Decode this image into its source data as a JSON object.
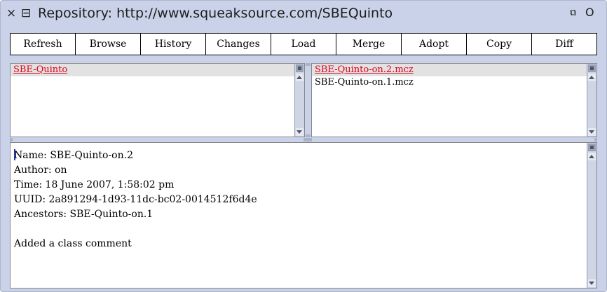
{
  "window": {
    "title": "Repository: http://www.squeaksource.com/SBEQuinto",
    "icons": {
      "close": "close-icon",
      "menu": "window-menu-icon",
      "collapse": "collapse-icon",
      "expand": "expand-icon"
    },
    "glyphs": {
      "close": "×",
      "menu": "⊟",
      "collapse": "⧉",
      "expand": "O"
    }
  },
  "toolbar": {
    "buttons": [
      "Refresh",
      "Browse",
      "History",
      "Changes",
      "Load",
      "Merge",
      "Adopt",
      "Copy",
      "Diff"
    ]
  },
  "packages": {
    "items": [
      "SBE-Quinto"
    ],
    "selected_index": 0
  },
  "versions": {
    "items": [
      "SBE-Quinto-on.2.mcz",
      "SBE-Quinto-on.1.mcz"
    ],
    "selected_index": 0
  },
  "details": {
    "lines": [
      "Name: SBE-Quinto-on.2",
      "Author: on",
      "Time: 18 June 2007, 1:58:02 pm",
      "UUID: 2a891294-1d93-11dc-bc02-0014512f6d4e",
      "Ancestors: SBE-Quinto-on.1",
      "",
      "Added a class comment"
    ]
  },
  "colors": {
    "window_frame": "#c9d2e8",
    "selection_text": "#e0001a",
    "selection_background": "#e2e2e2"
  }
}
